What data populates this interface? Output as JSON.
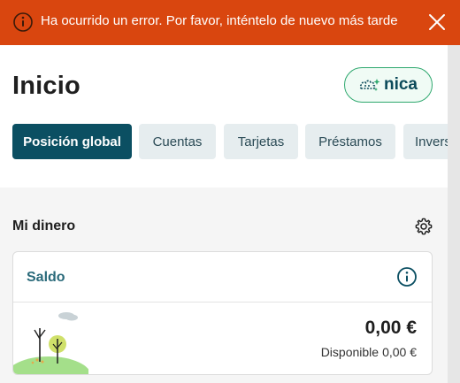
{
  "error_banner": {
    "message": "Ha ocurrido un error. Por favor, inténtelo de nuevo más tarde",
    "icon": "warning-info-icon",
    "close_icon": "close-icon",
    "color": "#d9460f"
  },
  "header": {
    "title": "Inicio",
    "assistant_button": {
      "label": "nica",
      "icon": "nica-assistant-icon"
    }
  },
  "tabs": [
    {
      "label": "Posición global",
      "active": true
    },
    {
      "label": "Cuentas",
      "active": false
    },
    {
      "label": "Tarjetas",
      "active": false
    },
    {
      "label": "Préstamos",
      "active": false
    },
    {
      "label": "Invers",
      "active": false
    }
  ],
  "section": {
    "title": "Mi dinero",
    "settings_icon": "gear-icon"
  },
  "balance_card": {
    "title": "Saldo",
    "info_icon": "info-icon",
    "amount": "0,00 €",
    "available_label": "Disponible",
    "available_value": "0,00 €"
  },
  "colors": {
    "primary": "#0b4f62",
    "accent_green": "#2ea86e",
    "card_title": "#2a6a7a"
  }
}
